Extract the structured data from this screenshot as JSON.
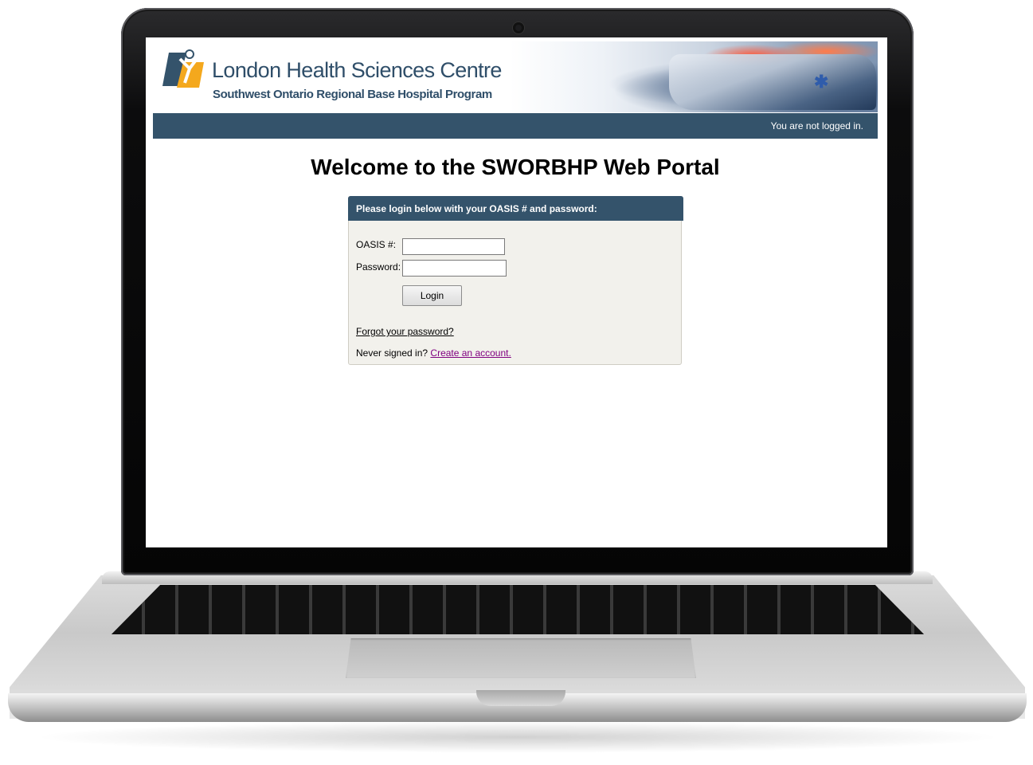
{
  "header": {
    "org_name": "London Health Sciences Centre",
    "org_subtitle": "Southwest Ontario Regional Base Hospital Program",
    "brand_color": "#2f4e69",
    "logo_colors": [
      "#f4a81d",
      "#2f4e69"
    ]
  },
  "navbar": {
    "status_text": "You are not logged in.",
    "bar_color": "#34536b"
  },
  "page": {
    "title": "Welcome to the SWORBHP Web Portal"
  },
  "login": {
    "header": "Please login below with your OASIS # and password:",
    "oasis_label": "OASIS #:",
    "oasis_value": "",
    "password_label": "Password:",
    "password_value": "",
    "login_button": "Login",
    "forgot_link": "Forgot your password?",
    "signup_prefix": "Never signed in?",
    "signup_link": "Create an account."
  }
}
